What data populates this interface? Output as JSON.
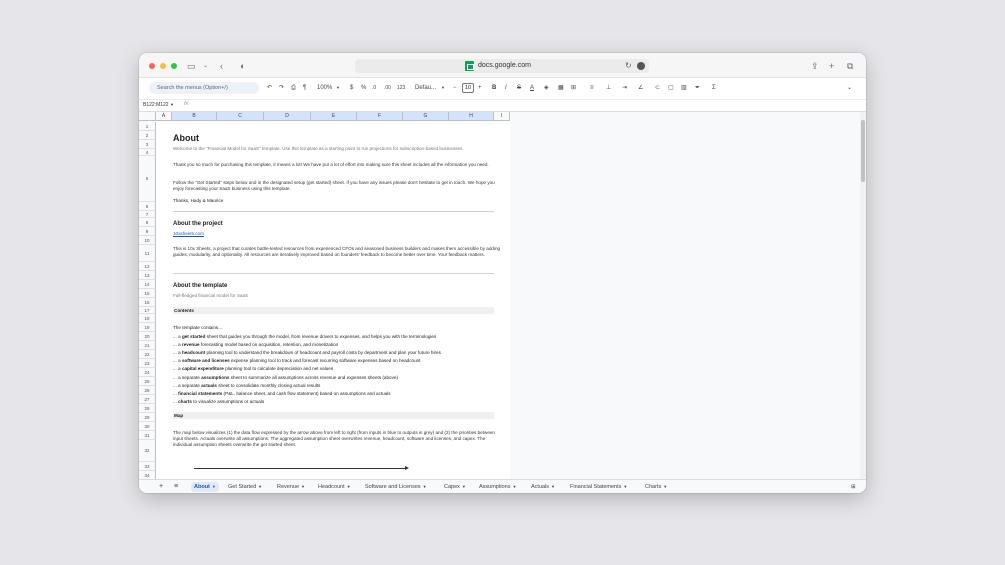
{
  "browser": {
    "url": "docs.google.com"
  },
  "toolbar": {
    "search_placeholder": "Search the menus (Option+/)",
    "zoom": "100%",
    "currency": "$",
    "percent": "%",
    "dec_less": ".0",
    "dec_more": ".00",
    "number_format": "123",
    "font": "Defau...",
    "font_size": "10",
    "minus": "−",
    "plus": "+",
    "bold": "B",
    "italic": "I",
    "strike": "S",
    "text_color": "A",
    "sum": "Σ"
  },
  "formula_bar": {
    "cell_ref": "B122:M122",
    "fx": "fx"
  },
  "columns": [
    "A",
    "B",
    "C",
    "D",
    "E",
    "F",
    "G",
    "H",
    "I"
  ],
  "rows": [
    "1",
    "2",
    "3",
    "4",
    "5",
    "6",
    "7",
    "8",
    "9",
    "10",
    "11",
    "12",
    "13",
    "14",
    "15",
    "16",
    "17",
    "18",
    "19",
    "20",
    "21",
    "22",
    "23",
    "24",
    "25",
    "26",
    "27",
    "28",
    "29",
    "30",
    "31",
    "32",
    "33",
    "34",
    "35",
    "36"
  ],
  "content": {
    "about_title": "About",
    "welcome": "Welcome to the \"Financial Model for SaaS\" template. Use this template as a starting point to run projections for subscription-based businesses.",
    "thanks_p": "Thank you so much for purchasing this template, it means a lot! We have put a lot of effort into making sure this sheet includes all the information you need.",
    "follow_p": "Follow the \"Get Started\" steps below and in the designated setup (get started) sheet. If you have any issues please don't hesitate to get in touch. We hope you enjoy forecasting your SaaS business using this template.",
    "signoff": "Thanks, Hady & Maurice",
    "project_title": "About the project",
    "project_link": "10xsheets.com",
    "project_p": "This is 10x Sheets, a project that curates battle-tested resources from experienced CFOs and seasoned business builders and makes them accessible by adding guides, modularity, and optionality. All resources are iteratively improved based on founders' feedback to become better over time. Your feedback matters.",
    "template_title": "About the template",
    "template_sub": "Full-fledged financial model for SaaS",
    "contents_label": "Contents",
    "template_contains": "The template contains...",
    "list": [
      {
        "pre": "... a ",
        "bold": "get started",
        "post": " sheet that guides you through the model, from revenue drivers to expenses, and helps you with the terminologies"
      },
      {
        "pre": "... a ",
        "bold": "revenue",
        "post": " forecasting model based on acquisition, retention, and monetization"
      },
      {
        "pre": "... a ",
        "bold": "headcount",
        "post": " planning tool to understand the breakdown of headcount and payroll costs by department and plan your future hires"
      },
      {
        "pre": "... a ",
        "bold": "software and licenses",
        "post": " expense planning tool to track and forecast recurring software expenses based on headcount"
      },
      {
        "pre": "... a ",
        "bold": "capital expenditure",
        "post": " planning tool to calculate depreciation and net values"
      },
      {
        "pre": "... a separate ",
        "bold": "assumptions",
        "post": " sheet to summarize all assumptions across revenue and expenses sheets (above)"
      },
      {
        "pre": "... a separate ",
        "bold": "actuals",
        "post": " sheet to consolidate monthly closing actual results"
      },
      {
        "pre": "... ",
        "bold": "financial statements",
        "post": " (P&L, balance sheet, and cash flow statement) based on assumptions and actuals"
      },
      {
        "pre": "... ",
        "bold": "charts",
        "post": " to visualize assumptions or actuals"
      }
    ],
    "map_label": "Map",
    "map_p": "The map below visualizes (1) the data flow expressed by the arrow above from left to right (from inputs in blue to outputs in grey) and (2) the priorities between input sheets. Actuals overwrite all assumptions. The aggregated assumption sheet overwrites revenue, headcount, software and licenses, and capex. The individual assumption sheets overwrite the get started sheet."
  },
  "tabs": [
    {
      "label": "About",
      "active": true
    },
    {
      "label": "Get Started"
    },
    {
      "label": "Revenue"
    },
    {
      "label": "Headcount"
    },
    {
      "label": "Software and Licenses"
    },
    {
      "label": "Capex"
    },
    {
      "label": "Assumptions"
    },
    {
      "label": "Actuals"
    },
    {
      "label": "Financial Statements"
    },
    {
      "label": "Charts"
    }
  ],
  "tab_bar": {
    "add": "+",
    "all_sheets": "≡"
  },
  "colors": {
    "accent": "#1a73e8",
    "link": "#1155cc",
    "active_tab": "#e1e9f7"
  }
}
